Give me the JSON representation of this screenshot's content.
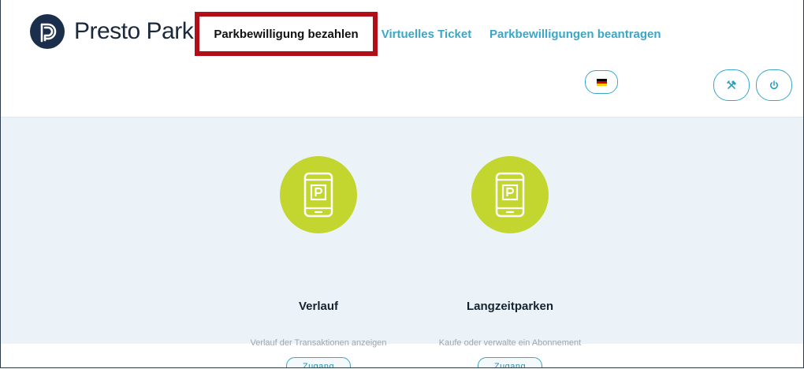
{
  "app": {
    "logo_text": "Presto Park"
  },
  "nav": {
    "items": [
      {
        "label": "Parkbewilligung bezahlen",
        "active": true
      },
      {
        "label": "Virtuelles Ticket",
        "active": false
      },
      {
        "label": "Parkbewilligungen beantragen",
        "active": false
      }
    ]
  },
  "header_actions": {
    "language": "de",
    "flag_colors": [
      "#000000",
      "#dd0000",
      "#ffce00"
    ],
    "icons": [
      "tools-icon",
      "power-icon"
    ]
  },
  "cards": [
    {
      "title": "Verlauf",
      "description": "Verlauf der Transaktionen anzeigen",
      "button_label": "Zugang",
      "icon": "phone-parking-icon"
    },
    {
      "title": "Langzeitparken",
      "description": "Kaufe oder verwalte ein Abonnement",
      "button_label": "Zugang",
      "icon": "phone-parking-icon"
    }
  ],
  "colors": {
    "accent": "#3aa7c9",
    "highlight_border": "#b30d18",
    "icon_circle": "#c3d52f",
    "content_bg": "#ebf3f8",
    "logo_bg": "#1b2f4d"
  }
}
